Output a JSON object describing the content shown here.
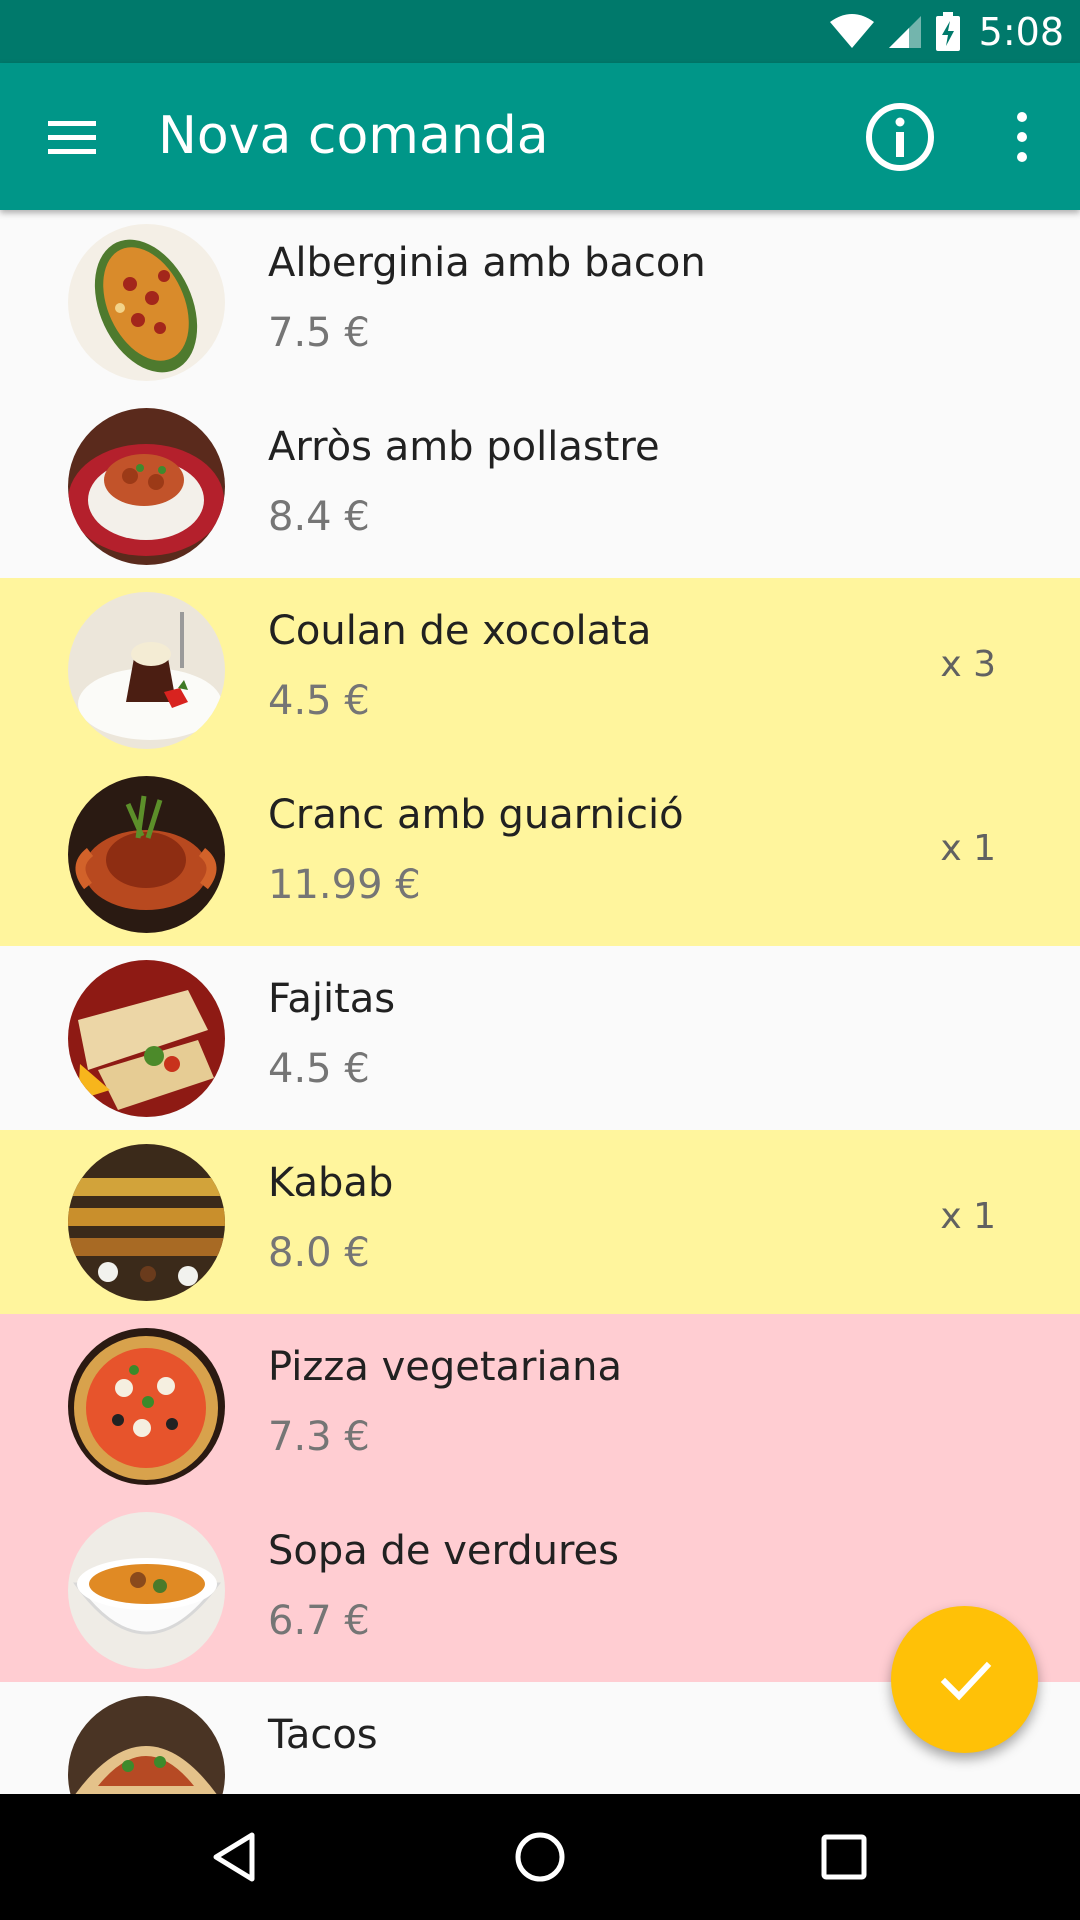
{
  "status_bar": {
    "time": "5:08",
    "icons": [
      "wifi-icon",
      "cell-signal-icon",
      "battery-charging-icon"
    ]
  },
  "toolbar": {
    "title": "Nova comanda",
    "icons": [
      "menu-icon",
      "info-icon",
      "more-vert-icon"
    ],
    "color": "#009688"
  },
  "dishes": [
    {
      "name": "Alberginia amb bacon",
      "price": "7.5 €",
      "qty": "",
      "state": "none"
    },
    {
      "name": "Arròs amb pollastre",
      "price": "8.4 €",
      "qty": "",
      "state": "none"
    },
    {
      "name": "Coulan de xocolata",
      "price": "4.5 €",
      "qty": "x 3",
      "state": "yellow"
    },
    {
      "name": "Cranc amb guarnició",
      "price": "11.99 €",
      "qty": "x 1",
      "state": "yellow"
    },
    {
      "name": "Fajitas",
      "price": "4.5 €",
      "qty": "",
      "state": "none"
    },
    {
      "name": "Kabab",
      "price": "8.0 €",
      "qty": "x 1",
      "state": "yellow"
    },
    {
      "name": "Pizza vegetariana",
      "price": "7.3 €",
      "qty": "",
      "state": "pink"
    },
    {
      "name": "Sopa de verdures",
      "price": "6.7 €",
      "qty": "",
      "state": "pink"
    },
    {
      "name": "Tacos",
      "price": "",
      "qty": "",
      "state": "none"
    }
  ],
  "fab": {
    "icon": "check-icon",
    "color": "#ffc107"
  },
  "nav_bar": {
    "icons": [
      "back-icon",
      "home-icon",
      "recents-icon"
    ]
  },
  "colors": {
    "primary_dark": "#00796b",
    "selected_yellow": "#fff59d",
    "selected_pink": "#ffcdd2"
  }
}
